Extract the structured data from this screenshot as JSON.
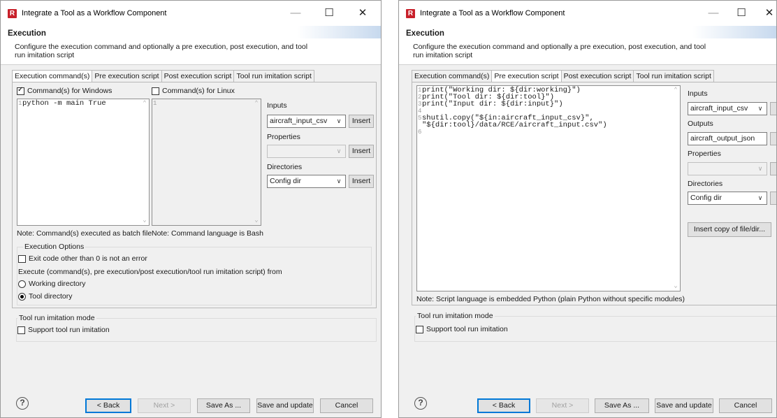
{
  "windows": [
    {
      "title": "Integrate a Tool as a Workflow Component",
      "app_icon": "R",
      "controls": {
        "minimize": "—",
        "maximize": "☐",
        "close": "✕"
      },
      "header": {
        "title": "Execution",
        "description": "Configure the execution command and optionally a pre execution, post execution, and tool run imitation script"
      },
      "tabs": [
        "Execution command(s)",
        "Pre execution script",
        "Post execution script",
        "Tool run imitation script"
      ],
      "active_tab": 0,
      "windows_checkbox": {
        "label": "Command(s) for Windows",
        "checked": true
      },
      "linux_checkbox": {
        "label": "Command(s) for Linux",
        "checked": false
      },
      "windows_editor": {
        "lines": [
          {
            "n": "1",
            "text": "python -m main True"
          }
        ]
      },
      "linux_editor": {
        "lines": [
          {
            "n": "1",
            "text": ""
          }
        ]
      },
      "side": {
        "inputs_label": "Inputs",
        "inputs_value": "aircraft_input_csv",
        "insert_label": "Insert",
        "properties_label": "Properties",
        "properties_value": "",
        "directories_label": "Directories",
        "directories_value": "Config dir"
      },
      "note_windows": "Note: Command(s) executed as batch file",
      "note_linux": "Note: Command language is Bash",
      "exec_options": {
        "title": "Execution Options",
        "exit_code_label": "Exit code other than 0 is not an error",
        "exit_code_checked": false,
        "execute_from_label": "Execute (command(s), pre execution/post execution/tool run imitation script) from",
        "working_dir_label": "Working directory",
        "tool_dir_label": "Tool directory",
        "selected": "tool"
      },
      "imitation": {
        "title": "Tool run imitation mode",
        "support_label": "Support tool run imitation",
        "checked": false
      },
      "footer": {
        "help": "?",
        "back": "< Back",
        "next": "Next >",
        "save_as": "Save As ...",
        "save_update": "Save and update",
        "cancel": "Cancel"
      }
    },
    {
      "title": "Integrate a Tool as a Workflow Component",
      "app_icon": "R",
      "controls": {
        "minimize": "—",
        "maximize": "☐",
        "close": "✕"
      },
      "header": {
        "title": "Execution",
        "description": "Configure the execution command and optionally a pre execution, post execution, and tool run imitation script"
      },
      "tabs": [
        "Execution command(s)",
        "Pre execution script",
        "Post execution script",
        "Tool run imitation script"
      ],
      "active_tab": 1,
      "script_editor": {
        "lines": [
          {
            "n": "1",
            "text": "print(\"Working dir: ${dir:working}\")"
          },
          {
            "n": "2",
            "text": "print(\"Tool dir: ${dir:tool}\")"
          },
          {
            "n": "3",
            "text": "print(\"Input dir: ${dir:input}\")"
          },
          {
            "n": "4",
            "text": ""
          },
          {
            "n": "5",
            "text": "shutil.copy(\"${in:aircraft_input_csv}\","
          },
          {
            "n": "",
            "text": "\"${dir:tool}/data/RCE/aircraft_input.csv\")"
          },
          {
            "n": "6",
            "text": ""
          }
        ]
      },
      "side": {
        "inputs_label": "Inputs",
        "inputs_value": "aircraft_input_csv",
        "outputs_label": "Outputs",
        "outputs_value": "aircraft_output_json",
        "properties_label": "Properties",
        "properties_value": "",
        "directories_label": "Directories",
        "directories_value": "Config dir",
        "insert_copy_label": "Insert copy of file/dir..."
      },
      "note": "Note: Script language is embedded Python (plain Python without specific modules)",
      "imitation": {
        "title": "Tool run imitation mode",
        "support_label": "Support tool run imitation",
        "checked": false
      },
      "footer": {
        "help": "?",
        "back": "< Back",
        "next": "Next >",
        "save_as": "Save As ...",
        "save_update": "Save and update",
        "cancel": "Cancel"
      }
    }
  ]
}
